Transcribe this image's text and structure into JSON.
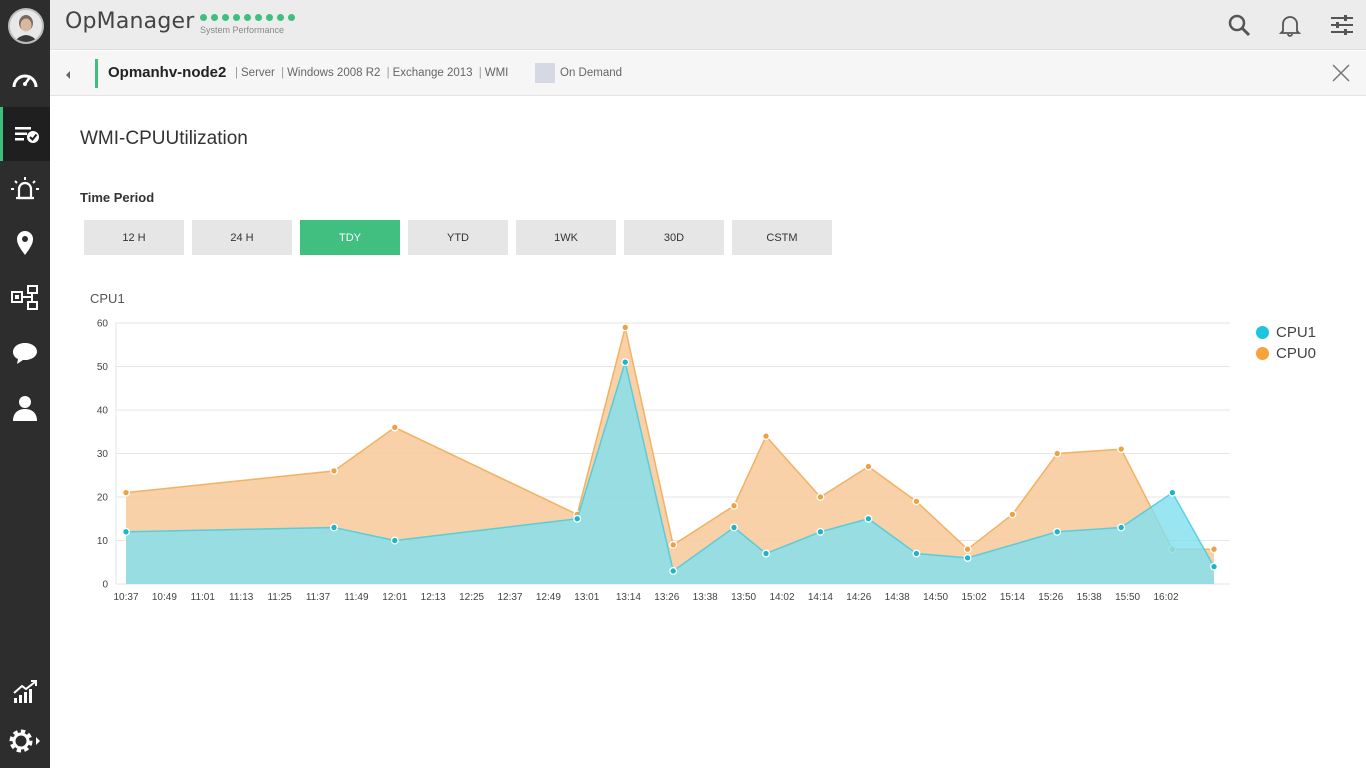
{
  "app": {
    "title": "OpManager",
    "subtitle": "System Performance"
  },
  "colors": {
    "accent": "#3dbf7e",
    "cpu1": "#7fe0ef",
    "cpu1_line": "#3ec9de",
    "cpu0": "#f7c999",
    "cpu0_line": "#f0a548"
  },
  "sidebar": {
    "items": [
      {
        "icon": "dashboard-gauge-icon"
      },
      {
        "icon": "inventory-list-icon",
        "active": true
      },
      {
        "icon": "alarms-icon"
      },
      {
        "icon": "maps-location-icon"
      },
      {
        "icon": "workflow-icon"
      },
      {
        "icon": "chat-icon"
      },
      {
        "icon": "user-icon"
      },
      {
        "icon": "reports-icon"
      },
      {
        "icon": "settings-gear-icon"
      }
    ]
  },
  "breadcrumb": {
    "device": "Opmanhv-node2",
    "meta": [
      "Server",
      "Windows 2008 R2",
      "Exchange 2013",
      "WMI"
    ],
    "on_demand": "On Demand"
  },
  "page": {
    "title": "WMI-CPUUtilization",
    "time_period_label": "Time Period",
    "periods": [
      "12 H",
      "24 H",
      "TDY",
      "YTD",
      "1WK",
      "30D",
      "CSTM"
    ],
    "active_period": "TDY"
  },
  "chart_data": {
    "type": "area",
    "title": "CPU1",
    "ylim": [
      0,
      60
    ],
    "yticks": [
      0,
      10,
      20,
      30,
      40,
      50,
      60
    ],
    "xticks": [
      "10:37",
      "10:49",
      "11:01",
      "11:13",
      "11:25",
      "11:37",
      "11:49",
      "12:01",
      "12:13",
      "12:25",
      "12:37",
      "12:49",
      "13:01",
      "13:14",
      "13:26",
      "13:38",
      "13:50",
      "14:02",
      "14:14",
      "14:26",
      "14:38",
      "14:50",
      "15:02",
      "15:14",
      "15:26",
      "15:38",
      "15:50",
      "16:02"
    ],
    "legend_position": "top-right",
    "series": [
      {
        "name": "CPU1",
        "points": [
          {
            "x": "10:37",
            "y": 12
          },
          {
            "x": "11:42",
            "y": 13
          },
          {
            "x": "12:01",
            "y": 10
          },
          {
            "x": "12:58",
            "y": 15
          },
          {
            "x": "13:13",
            "y": 51
          },
          {
            "x": "13:28",
            "y": 3
          },
          {
            "x": "13:47",
            "y": 13
          },
          {
            "x": "13:57",
            "y": 7
          },
          {
            "x": "14:14",
            "y": 12
          },
          {
            "x": "14:29",
            "y": 15
          },
          {
            "x": "14:44",
            "y": 7
          },
          {
            "x": "15:00",
            "y": 6
          },
          {
            "x": "15:28",
            "y": 12
          },
          {
            "x": "15:48",
            "y": 13
          },
          {
            "x": "16:04",
            "y": 21
          },
          {
            "x": "16:17",
            "y": 4
          }
        ]
      },
      {
        "name": "CPU0",
        "points": [
          {
            "x": "10:37",
            "y": 21
          },
          {
            "x": "11:42",
            "y": 26
          },
          {
            "x": "12:01",
            "y": 36
          },
          {
            "x": "12:58",
            "y": 16
          },
          {
            "x": "13:13",
            "y": 59
          },
          {
            "x": "13:28",
            "y": 9
          },
          {
            "x": "13:47",
            "y": 18
          },
          {
            "x": "13:57",
            "y": 34
          },
          {
            "x": "14:14",
            "y": 20
          },
          {
            "x": "14:29",
            "y": 27
          },
          {
            "x": "14:44",
            "y": 19
          },
          {
            "x": "15:00",
            "y": 8
          },
          {
            "x": "15:14",
            "y": 16
          },
          {
            "x": "15:28",
            "y": 30
          },
          {
            "x": "15:48",
            "y": 31
          },
          {
            "x": "16:04",
            "y": 8
          },
          {
            "x": "16:17",
            "y": 8
          }
        ]
      }
    ]
  }
}
